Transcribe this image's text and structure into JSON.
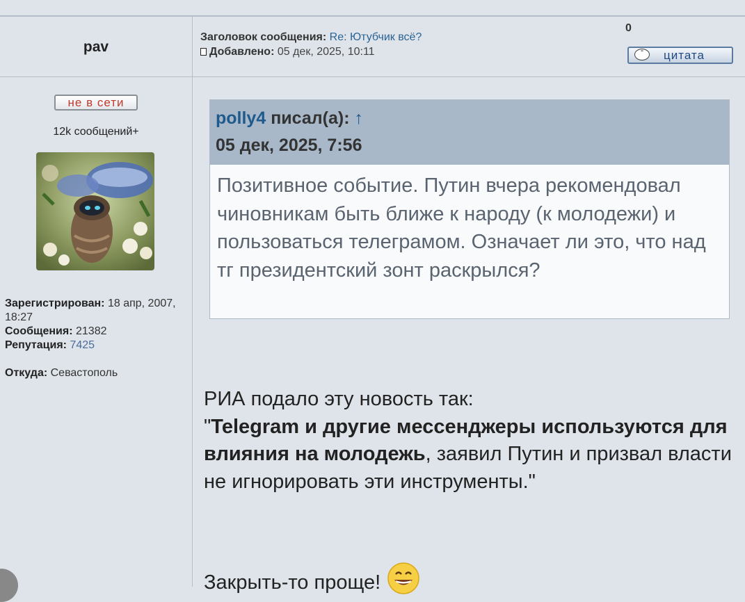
{
  "header": {
    "username": "pav",
    "subject_label": "Заголовок сообщения:",
    "subject_value": "Re: Ютубчик всё?",
    "added_label": "Добавлено:",
    "added_value": "05 дек, 2025, 10:11",
    "counter": "0",
    "quote_button": "цитата"
  },
  "sidebar": {
    "status_badge": "не в сети",
    "post_count": "12k сообщений+",
    "registered_label": "Зарегистрирован:",
    "registered_value": "18 апр, 2007, 18:27",
    "posts_label": "Сообщения:",
    "posts_value": "21382",
    "reputation_label": "Репутация:",
    "reputation_value": "7425",
    "location_label": "Откуда:",
    "location_value": "Севастополь"
  },
  "quote": {
    "author": "polly4",
    "wrote": " писал(а):",
    "arrow": "↑",
    "date": "05 дек, 2025, 7:56",
    "text": "Позитивное событие. Путин вчера рекомендовал чиновникам быть ближе к народу (к молодежи) и пользоваться телеграмом. Означает ли это, что над тг президентский зонт раскрылся?"
  },
  "post": {
    "line1": "РИА подало эту новость так:",
    "quote_open": "\"",
    "bold": "Telegram и другие мессенджеры используются для влияния на молодежь",
    "rest": ", заявил Путин и призвал власти не игнорировать эти инструменты.\"",
    "closing": "Закрыть-то проще!"
  },
  "icons": {
    "page": "page-icon",
    "quote_bubble": "speech-bubble-icon",
    "avatar": "avatar-image",
    "smile": "grin-smiley-icon"
  },
  "colors": {
    "background": "#dfe4ea",
    "quote_header": "#a8b8c8",
    "link": "#2a6496",
    "offline_text": "#c0392b"
  }
}
